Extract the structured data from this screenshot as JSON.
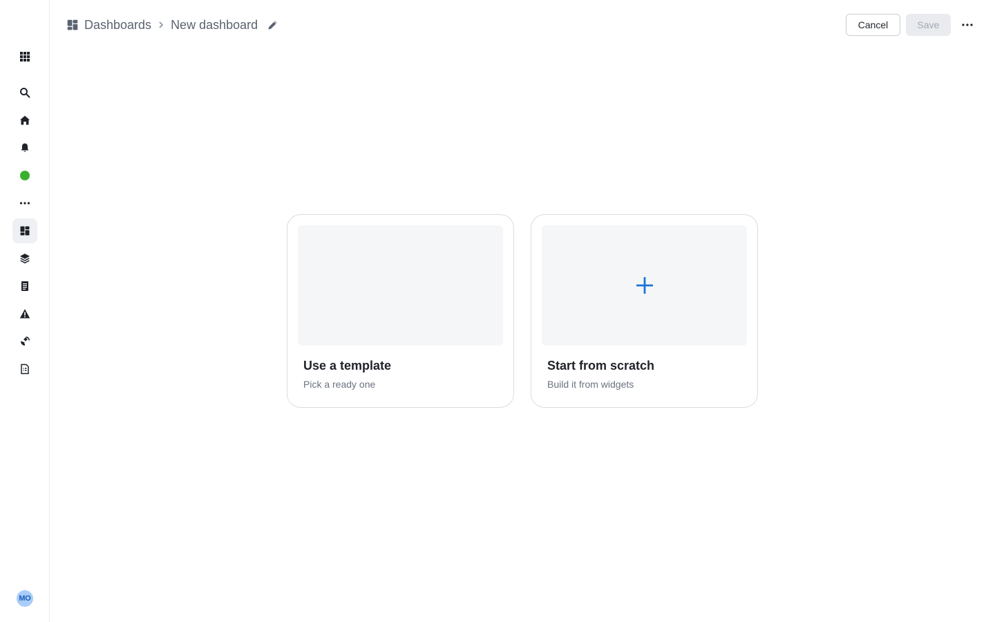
{
  "sidebar": {
    "items": [
      {
        "name": "apps-grid-icon"
      },
      {
        "name": "search-icon"
      },
      {
        "name": "home-icon"
      },
      {
        "name": "notifications-bell-icon"
      },
      {
        "name": "status-dot-icon",
        "color": "#3bb02f"
      },
      {
        "name": "more-horizontal-icon"
      },
      {
        "name": "dashboards-icon",
        "active": true
      },
      {
        "name": "layers-icon"
      },
      {
        "name": "document-icon"
      },
      {
        "name": "warning-icon"
      },
      {
        "name": "satellite-icon"
      },
      {
        "name": "report-icon"
      }
    ],
    "avatar_initials": "MO"
  },
  "header": {
    "breadcrumb_root": "Dashboards",
    "breadcrumb_current": "New dashboard",
    "cancel_label": "Cancel",
    "save_label": "Save"
  },
  "options": [
    {
      "title": "Use a template",
      "subtitle": "Pick a ready one"
    },
    {
      "title": "Start from scratch",
      "subtitle": "Build it from widgets",
      "icon": "plus-icon",
      "icon_color": "#1a73d9"
    }
  ]
}
